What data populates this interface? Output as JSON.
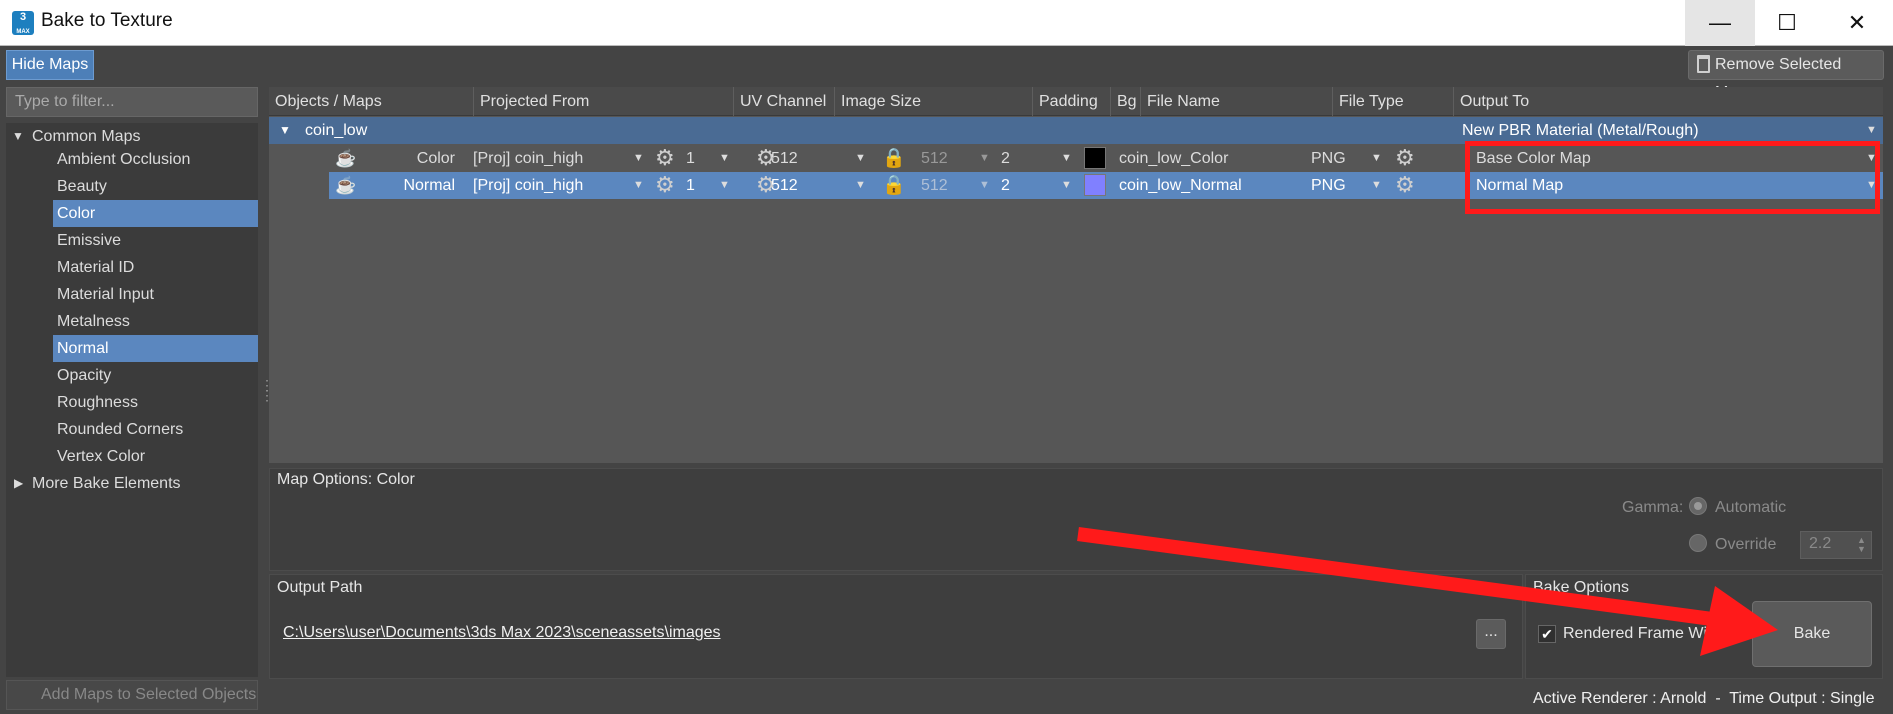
{
  "window": {
    "title": "Bake to Texture",
    "app_icon_text": "3\nMAX",
    "controls": {
      "minimize": "—",
      "maximize": "☐",
      "close": "✕"
    }
  },
  "toolbar": {
    "hide_maps": "Hide Maps",
    "remove_selected_maps": "Remove Selected Maps"
  },
  "sidebar": {
    "filter_placeholder": "Type to filter...",
    "groups": [
      {
        "label": "Common Maps",
        "expanded": true
      },
      {
        "label": "More Bake Elements",
        "expanded": false
      }
    ],
    "items": [
      {
        "label": "Ambient Occlusion",
        "selected": false
      },
      {
        "label": "Beauty",
        "selected": false
      },
      {
        "label": "Color",
        "selected": true
      },
      {
        "label": "Emissive",
        "selected": false
      },
      {
        "label": "Material ID",
        "selected": false
      },
      {
        "label": "Material Input",
        "selected": false
      },
      {
        "label": "Metalness",
        "selected": false
      },
      {
        "label": "Normal",
        "selected": true
      },
      {
        "label": "Opacity",
        "selected": false
      },
      {
        "label": "Roughness",
        "selected": false
      },
      {
        "label": "Rounded Corners",
        "selected": false
      },
      {
        "label": "Vertex Color",
        "selected": false
      }
    ],
    "add_maps": "Add Maps to Selected Objects"
  },
  "table": {
    "columns": [
      "Objects / Maps",
      "Projected From",
      "UV Channel",
      "Image Size",
      "Padding",
      "Bg",
      "File Name",
      "File Type",
      "Output To"
    ],
    "object": {
      "name": "coin_low",
      "output_to": "New PBR Material (Metal/Rough)"
    },
    "rows": [
      {
        "map": "Color",
        "projected_from": "[Proj] coin_high",
        "uv_channel": "1",
        "width": "512",
        "height": "512",
        "padding": "2",
        "bg_color": "#000000",
        "file_name": "coin_low_Color",
        "file_type": "PNG",
        "output_to": "Base Color Map",
        "selected": false
      },
      {
        "map": "Normal",
        "projected_from": "[Proj] coin_high",
        "uv_channel": "1",
        "width": "512",
        "height": "512",
        "padding": "2",
        "bg_color": "#8080ff",
        "file_name": "coin_low_Normal",
        "file_type": "PNG",
        "output_to": "Normal Map",
        "selected": true
      }
    ]
  },
  "map_options": {
    "title": "Map Options: Color",
    "gamma_label": "Gamma:",
    "automatic": "Automatic",
    "override": "Override",
    "override_value": "2.2"
  },
  "output": {
    "title": "Output Path",
    "path": "C:\\Users\\user\\Documents\\3ds Max 2023\\sceneassets\\images",
    "browse": "..."
  },
  "bake_options": {
    "title": "Bake Options",
    "rendered_frame_window": "Rendered Frame Wind",
    "rendered_frame_window_checked": true,
    "bake": "Bake"
  },
  "status": "Active Renderer : Arnold  -  Time Output : Single",
  "annotation_color": "#ff1a1a"
}
